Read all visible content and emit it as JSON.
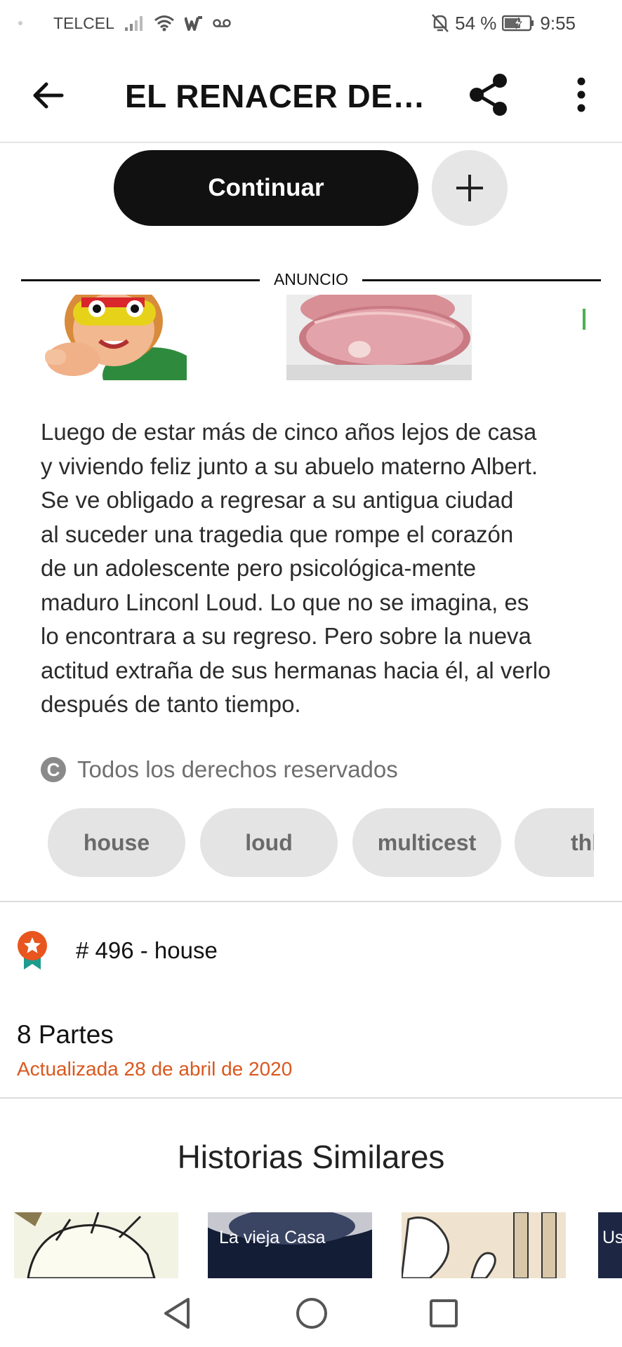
{
  "status_bar": {
    "carrier": "TELCEL",
    "battery": "54 %",
    "time": "9:55"
  },
  "header": {
    "title": "EL RENACER DE L...",
    "icons": {
      "back": "arrow-left",
      "share": "share",
      "more": "dots-vertical"
    }
  },
  "actions": {
    "continue_label": "Continuar",
    "add_icon": "plus"
  },
  "ad": {
    "label": "ANUNCIO"
  },
  "story": {
    "description": "Luego de estar más de cinco años lejos de casa\ny viviendo feliz junto a su abuelo materno Albert.\nSe ve obligado a regresar a su antigua ciudad\nal suceder una tragedia que rompe el corazón\nde un adolescente pero psicológica-mente\nmaduro  Linconl Loud. Lo que no se imagina, es\nlo encontrara a su regreso. Pero sobre la nueva\nactitud extraña de sus hermanas hacia  él, al verlo\ndespués de tanto tiempo.",
    "copyright": "Todos los derechos reservados",
    "copyright_symbol": "C",
    "tags": [
      "house",
      "loud",
      "multicest",
      "thl"
    ],
    "rank": "# 496 - house",
    "parts": "8 Partes",
    "updated": "Actualizada 28 de abril de 2020"
  },
  "similar": {
    "title": "Historias Similares",
    "covers": [
      "",
      "La vieja Casa",
      "",
      "Us"
    ]
  },
  "colors": {
    "accent_orange": "#d9581f",
    "button_dark": "#111111",
    "tag_bg": "#e4e4e4"
  }
}
